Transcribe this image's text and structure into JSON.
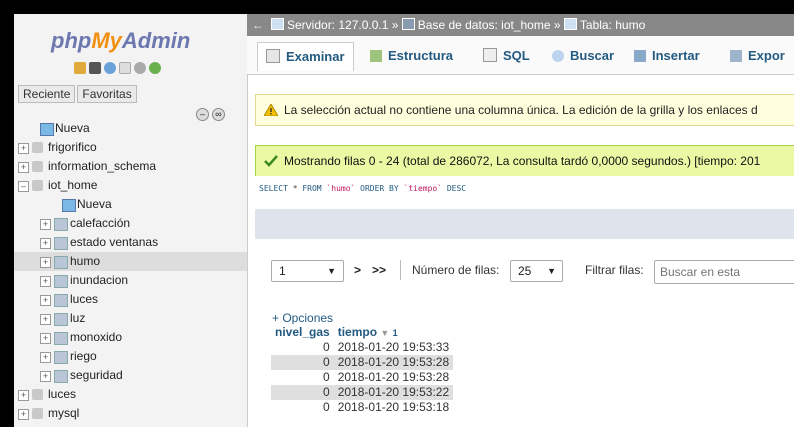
{
  "sidebar": {
    "logo": {
      "php": "php",
      "my": "My",
      "admin": "Admin"
    },
    "tabs": [
      "Reciente",
      "Favoritas"
    ],
    "tree": [
      {
        "label": "Nueva",
        "kind": "new",
        "level": 0
      },
      {
        "label": "frigorifico",
        "kind": "db",
        "level": 0
      },
      {
        "label": "information_schema",
        "kind": "db",
        "level": 0
      },
      {
        "label": "iot_home",
        "kind": "db",
        "level": 0,
        "expanded": true
      },
      {
        "label": "Nueva",
        "kind": "new",
        "level": 1
      },
      {
        "label": "calefacción",
        "kind": "table",
        "level": 1
      },
      {
        "label": "estado ventanas",
        "kind": "table",
        "level": 1
      },
      {
        "label": "humo",
        "kind": "table",
        "level": 1,
        "active": true
      },
      {
        "label": "inundacion",
        "kind": "table",
        "level": 1
      },
      {
        "label": "luces",
        "kind": "table",
        "level": 1
      },
      {
        "label": "luz",
        "kind": "table",
        "level": 1
      },
      {
        "label": "monoxido",
        "kind": "table",
        "level": 1
      },
      {
        "label": "riego",
        "kind": "table",
        "level": 1
      },
      {
        "label": "seguridad",
        "kind": "table",
        "level": 1
      },
      {
        "label": "luces",
        "kind": "db",
        "level": 0
      },
      {
        "label": "mysql",
        "kind": "db",
        "level": 0
      }
    ]
  },
  "breadcrumb": {
    "server": "Servidor: 127.0.0.1",
    "database": "Base de datos: iot_home",
    "table": "Tabla: humo"
  },
  "tabs": [
    {
      "label": "Examinar",
      "active": true
    },
    {
      "label": "Estructura"
    },
    {
      "label": "SQL"
    },
    {
      "label": "Buscar"
    },
    {
      "label": "Insertar"
    },
    {
      "label": "Expor"
    }
  ],
  "warning": "La selección actual no contiene una columna única. La edición de la grilla y los enlaces d",
  "success": "Mostrando filas 0 - 24 (total de 286072, La consulta tardó 0,0000 segundos.) [tiempo: 201",
  "sql": {
    "select": "SELECT",
    "star": " * ",
    "from": "FROM",
    "table": " `humo` ",
    "order": "ORDER BY",
    "col": " `tiempo` ",
    "desc": "DESC"
  },
  "navigation": {
    "page": "1",
    "next": ">",
    "last": ">>",
    "rows_label": "Número de filas:",
    "rows_value": "25",
    "filter_label": "Filtrar filas:",
    "filter_placeholder": "Buscar en esta"
  },
  "results": {
    "options_label": "+ Opciones",
    "headers": [
      "nivel_gas",
      "tiempo"
    ],
    "sort_marker": "1",
    "rows": [
      [
        "0",
        "2018-01-20 19:53:33"
      ],
      [
        "0",
        "2018-01-20 19:53:28"
      ],
      [
        "0",
        "2018-01-20 19:53:28"
      ],
      [
        "0",
        "2018-01-20 19:53:22"
      ],
      [
        "0",
        "2018-01-20 19:53:18"
      ]
    ]
  }
}
